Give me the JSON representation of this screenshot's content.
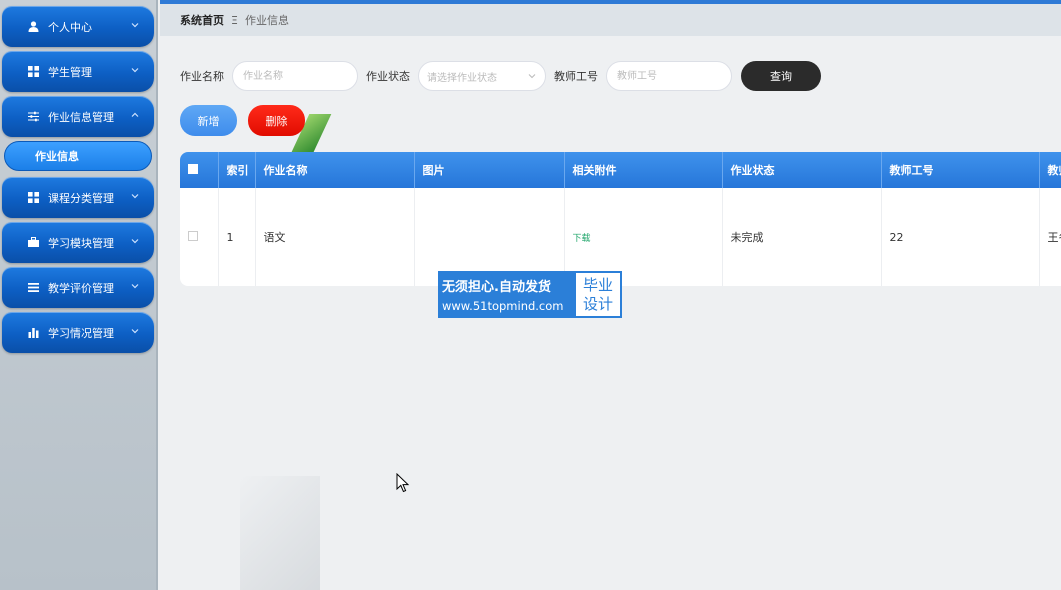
{
  "sidebar": {
    "items": [
      {
        "label": "个人中心",
        "icon": "user-icon"
      },
      {
        "label": "学生管理",
        "icon": "grid-icon"
      },
      {
        "label": "作业信息管理",
        "icon": "sliders-icon"
      },
      {
        "label": "课程分类管理",
        "icon": "grid-icon"
      },
      {
        "label": "学习模块管理",
        "icon": "briefcase-icon"
      },
      {
        "label": "教学评价管理",
        "icon": "list-icon"
      },
      {
        "label": "学习情况管理",
        "icon": "bar-chart-icon"
      }
    ],
    "submenu": {
      "label": "作业信息"
    }
  },
  "breadcrumb": {
    "home": "系统首页",
    "separator": "Ξ",
    "current": "作业信息"
  },
  "search": {
    "name_label": "作业名称",
    "name_placeholder": "作业名称",
    "status_label": "作业状态",
    "status_placeholder": "请选择作业状态",
    "teacher_label": "教师工号",
    "teacher_placeholder": "教师工号",
    "query_button": "查询"
  },
  "actions": {
    "add": "新增",
    "delete": "删除"
  },
  "table": {
    "headers": [
      "索引",
      "作业名称",
      "图片",
      "相关附件",
      "作业状态",
      "教师工号",
      "教师"
    ],
    "rows": [
      {
        "index": "1",
        "name": "语文",
        "image": "",
        "attachment": "下载",
        "status": "未完成",
        "teacher_id": "22",
        "teacher_name": "王冬"
      }
    ]
  },
  "watermark": {
    "line1": "无须担心.自动发货",
    "line2": "www.51topmind.com",
    "right1": "毕业",
    "right2": "设计"
  },
  "colors": {
    "sidebar_blue": "#0d5fc4",
    "header_blue": "#2676d9",
    "delete_red": "#e10c00",
    "query_dark": "#2b2b2b",
    "download_green": "#1fa56a"
  }
}
